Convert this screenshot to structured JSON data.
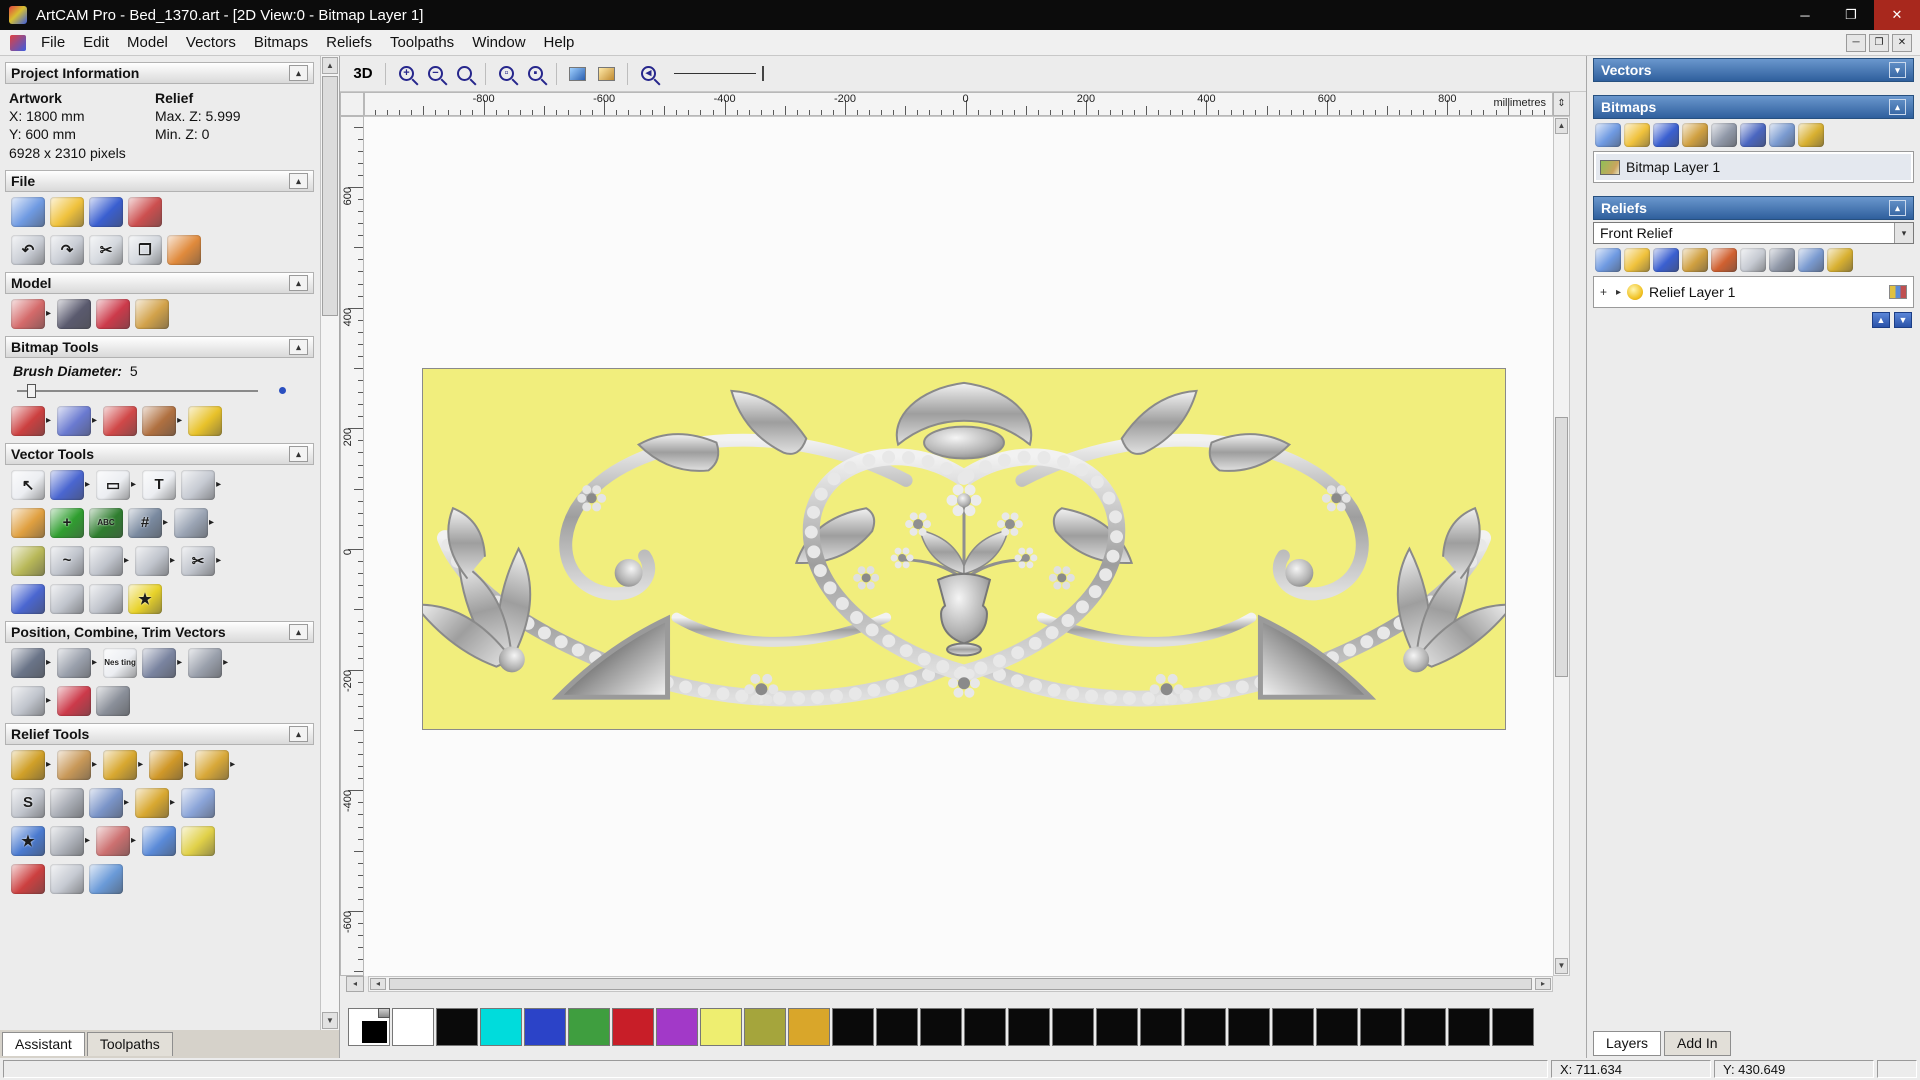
{
  "icons": {
    "collapse": "▴",
    "dropdown": "▾",
    "expand": "▸",
    "up": "▲",
    "down": "▼",
    "left": "◂",
    "right": "▸",
    "minimize": "─",
    "maximize": "❐",
    "close": "✕",
    "plus": "+",
    "updown": "⇕"
  },
  "window": {
    "title": "ArtCAM Pro - Bed_1370.art - [2D View:0 - Bitmap Layer 1]"
  },
  "menu": {
    "items": [
      "File",
      "Edit",
      "Model",
      "Vectors",
      "Bitmaps",
      "Reliefs",
      "Toolpaths",
      "Window",
      "Help"
    ]
  },
  "left_panel": {
    "tabs": [
      "Assistant",
      "Toolpaths"
    ],
    "project_info": {
      "title": "Project Information",
      "artwork_label": "Artwork",
      "relief_label": "Relief",
      "x": "X: 1800 mm",
      "y": "Y: 600 mm",
      "pixels": "6928 x 2310 pixels",
      "max_z": "Max. Z: 5.999",
      "min_z": "Min. Z: 0"
    },
    "file": {
      "title": "File",
      "row1": [
        {
          "n": "new-model",
          "g": "",
          "c": "#6f9ae2"
        },
        {
          "n": "open-model",
          "g": "",
          "c": "#f0c23c"
        },
        {
          "n": "save-model",
          "g": "",
          "c": "#3a5fd0"
        },
        {
          "n": "export-model",
          "g": "",
          "c": "#cc4f4f"
        }
      ],
      "row2": [
        {
          "n": "undo",
          "g": "↶",
          "c": "#c9cdd5"
        },
        {
          "n": "redo",
          "g": "↷",
          "c": "#c9cdd5"
        },
        {
          "n": "cut",
          "g": "✂",
          "c": "#d4d8de"
        },
        {
          "n": "copy",
          "g": "❐",
          "c": "#d4d8de"
        },
        {
          "n": "paste",
          "g": "",
          "c": "#e08a3c"
        }
      ]
    },
    "model": {
      "title": "Model",
      "row1": [
        {
          "n": "set-model-size",
          "g": "",
          "c": "#d46a6a",
          "dd": 1
        },
        {
          "n": "material-settings",
          "g": "",
          "c": "#5a5a6e"
        },
        {
          "n": "model-colours",
          "g": "",
          "c": "#cc3a4a"
        },
        {
          "n": "notes",
          "g": "",
          "c": "#d2a24a"
        }
      ]
    },
    "bitmap_tools": {
      "title": "Bitmap Tools",
      "brush_label": "Brush Diameter:",
      "brush_value": "5",
      "row1": [
        {
          "n": "paint",
          "g": "",
          "c": "#cc4040",
          "dd": 1
        },
        {
          "n": "paint-selective",
          "g": "",
          "c": "#6a7ad0",
          "dd": 1
        },
        {
          "n": "draw",
          "g": "",
          "c": "#d04848"
        },
        {
          "n": "colour-palette",
          "g": "",
          "c": "#b07040",
          "dd": 1
        },
        {
          "n": "flood-fill",
          "g": "",
          "c": "#e8c22a"
        }
      ]
    },
    "vector_tools": {
      "title": "Vector Tools",
      "row1": [
        {
          "n": "select-vectors",
          "g": "↖",
          "c": "#eceef2"
        },
        {
          "n": "transform-vectors",
          "g": "",
          "c": "#4a66d0",
          "dd": 1
        },
        {
          "n": "create-rectangle",
          "g": "▭",
          "c": "#eceef2",
          "dd": 1
        },
        {
          "n": "create-text",
          "g": "T",
          "c": "#eceef2"
        },
        {
          "n": "measure-tool",
          "g": "",
          "c": "#c6cad2",
          "dd": 1
        }
      ],
      "row2": [
        {
          "n": "create-freehand",
          "g": "",
          "c": "#e0a040"
        },
        {
          "n": "create-cross",
          "g": "+",
          "c": "#2f9e2f"
        },
        {
          "n": "text-tool",
          "g": "ABC",
          "c": "#2f7e2f"
        },
        {
          "n": "snap-grid",
          "g": "#",
          "c": "#7a8aa0",
          "dd": 1
        },
        {
          "n": "snap-settings",
          "g": "",
          "c": "#9aa4b4",
          "dd": 1
        }
      ],
      "row3": [
        {
          "n": "fit-arcs",
          "g": "",
          "c": "#b8b858"
        },
        {
          "n": "fit-curve",
          "g": "~",
          "c": "#c0c4cc"
        },
        {
          "n": "node-editing",
          "g": "",
          "c": "#c0c4cc",
          "dd": 1
        },
        {
          "n": "join-vectors",
          "g": "",
          "c": "#c0c4cc",
          "dd": 1
        },
        {
          "n": "trim-vectors",
          "g": "✂",
          "c": "#c0c4cc",
          "dd": 1
        }
      ],
      "row4": [
        {
          "n": "create-circle",
          "g": "",
          "c": "#4a66d0"
        },
        {
          "n": "mirror-vectors",
          "g": "",
          "c": "#c0c4cc"
        },
        {
          "n": "offset-vectors",
          "g": "",
          "c": "#c0c4cc"
        },
        {
          "n": "create-star",
          "g": "★",
          "c": "#e8d22a"
        }
      ]
    },
    "position_tools": {
      "title": "Position, Combine, Trim Vectors",
      "row1": [
        {
          "n": "align-vectors",
          "g": "",
          "c": "#6a7488",
          "dd": 1
        },
        {
          "n": "array-copy",
          "g": "",
          "c": "#9aa0ac",
          "dd": 1
        },
        {
          "n": "nesting",
          "g": "Nes ting",
          "c": "#eceef2"
        },
        {
          "n": "block-copy",
          "g": "",
          "c": "#7a84a0",
          "dd": 1
        },
        {
          "n": "group-merge",
          "g": "",
          "c": "#9aa0ac",
          "dd": 1
        }
      ],
      "row2": [
        {
          "n": "fillet-tool",
          "g": "",
          "c": "#c0c4cc",
          "dd": 1
        },
        {
          "n": "trim-overlap",
          "g": "",
          "c": "#cc3a4a"
        },
        {
          "n": "create-spiral",
          "g": "",
          "c": "#8a8f99"
        }
      ]
    },
    "relief_tools": {
      "title": "Relief Tools",
      "row1": [
        {
          "n": "shape-editor",
          "g": "",
          "c": "#d0a028",
          "dd": 1
        },
        {
          "n": "smooth-relief",
          "g": "",
          "c": "#c89858",
          "dd": 1
        },
        {
          "n": "sculpting-tool",
          "g": "",
          "c": "#d8a830",
          "dd": 1
        },
        {
          "n": "extrude-tool",
          "g": "",
          "c": "#d09828",
          "dd": 1
        },
        {
          "n": "spin-tool",
          "g": "",
          "c": "#d8a838",
          "dd": 1
        }
      ],
      "row2": [
        {
          "n": "two-rail-sweep",
          "g": "S",
          "c": "#c0c4cc"
        },
        {
          "n": "weave-wizard",
          "g": "",
          "c": "#a8acb4"
        },
        {
          "n": "texture-relief",
          "g": "",
          "c": "#7a94c8",
          "dd": 1
        },
        {
          "n": "turn-wizard",
          "g": "",
          "c": "#d8a830",
          "dd": 1
        },
        {
          "n": "face-wizard",
          "g": "",
          "c": "#8aa4d8"
        }
      ],
      "row3": [
        {
          "n": "star-wizard",
          "g": "★",
          "c": "#4a7ad0"
        },
        {
          "n": "weave-texture",
          "g": "",
          "c": "#b0b4bc",
          "dd": 1
        },
        {
          "n": "emboss-wizard",
          "g": "",
          "c": "#cc7070",
          "dd": 1
        },
        {
          "n": "dome-wizard",
          "g": "",
          "c": "#5a8ad8"
        },
        {
          "n": "plane-wizard",
          "g": "",
          "c": "#e0d048"
        }
      ],
      "row4": [
        {
          "n": "unwrap-relief",
          "g": "",
          "c": "#cc4040"
        },
        {
          "n": "mesh-tool",
          "g": "",
          "c": "#c6cad2"
        },
        {
          "n": "sphere-tool",
          "g": "",
          "c": "#6a9ad8"
        }
      ]
    }
  },
  "toolbar": {
    "btn_3d": "3D"
  },
  "ruler": {
    "unit": "millimetres",
    "h_labels": [
      -800,
      -600,
      -400,
      -200,
      0,
      200,
      400,
      600,
      800
    ],
    "v_labels": [
      600,
      400,
      200,
      0,
      -200,
      -400,
      -600
    ]
  },
  "right_panel": {
    "vectors_title": "Vectors",
    "bitmaps_title": "Bitmaps",
    "bitmaps_toolbar": [
      {
        "n": "new-bitmap-layer",
        "g": "",
        "c": "#6f9ae2"
      },
      {
        "n": "open-bitmap-layer",
        "g": "",
        "c": "#f0c23c"
      },
      {
        "n": "save-bitmap-layer",
        "g": "",
        "c": "#3a5fd0"
      },
      {
        "n": "duplicate-bitmap-layer",
        "g": "",
        "c": "#d0a040"
      },
      {
        "n": "merge-bitmap-layers",
        "g": "",
        "c": "#9098a8"
      },
      {
        "n": "bitmap-colours",
        "g": "",
        "c": "#4a66c0"
      },
      {
        "n": "delete-bitmap-layer",
        "g": "",
        "c": "#7a9ad0"
      },
      {
        "n": "bitmap-wizard",
        "g": "",
        "c": "#d8b030"
      }
    ],
    "bitmap_layers": [
      "Bitmap Layer 1"
    ],
    "reliefs_title": "Reliefs",
    "relief_selected": "Front Relief",
    "reliefs_toolbar": [
      {
        "n": "new-relief-layer",
        "g": "",
        "c": "#6f9ae2"
      },
      {
        "n": "open-relief-layer",
        "g": "",
        "c": "#f0c23c"
      },
      {
        "n": "save-relief-layer",
        "g": "",
        "c": "#3a5fd0"
      },
      {
        "n": "duplicate-relief-layer",
        "g": "",
        "c": "#d0a040"
      },
      {
        "n": "smooth-relief-layer",
        "g": "",
        "c": "#d06030"
      },
      {
        "n": "invert-relief-layer",
        "g": "",
        "c": "#c6cad2"
      },
      {
        "n": "scale-relief-layer",
        "g": "",
        "c": "#9098a8"
      },
      {
        "n": "delete-relief-layer",
        "g": "",
        "c": "#7a9ad0"
      },
      {
        "n": "relief-wizard",
        "g": "",
        "c": "#d8b030"
      }
    ],
    "relief_layers": [
      "Relief Layer 1"
    ],
    "tabs": [
      "Layers",
      "Add In"
    ]
  },
  "palette": {
    "colors": [
      "#ffffff",
      "#0a0a0a",
      "#00dcdc",
      "#2b43c8",
      "#3f9e3f",
      "#c81e28",
      "#a239c8",
      "#eeee70",
      "#a5a53c",
      "#d9a62a",
      "#0a0a0a",
      "#0a0a0a",
      "#0a0a0a",
      "#0a0a0a",
      "#0a0a0a",
      "#0a0a0a",
      "#0a0a0a",
      "#0a0a0a",
      "#0a0a0a",
      "#0a0a0a",
      "#0a0a0a",
      "#0a0a0a",
      "#0a0a0a",
      "#0a0a0a",
      "#0a0a0a",
      "#0a0a0a"
    ]
  },
  "status": {
    "x_readout": "X: 711.634",
    "y_readout": "Y: 430.649"
  },
  "artwork": {
    "background": "#f1ee7d"
  }
}
